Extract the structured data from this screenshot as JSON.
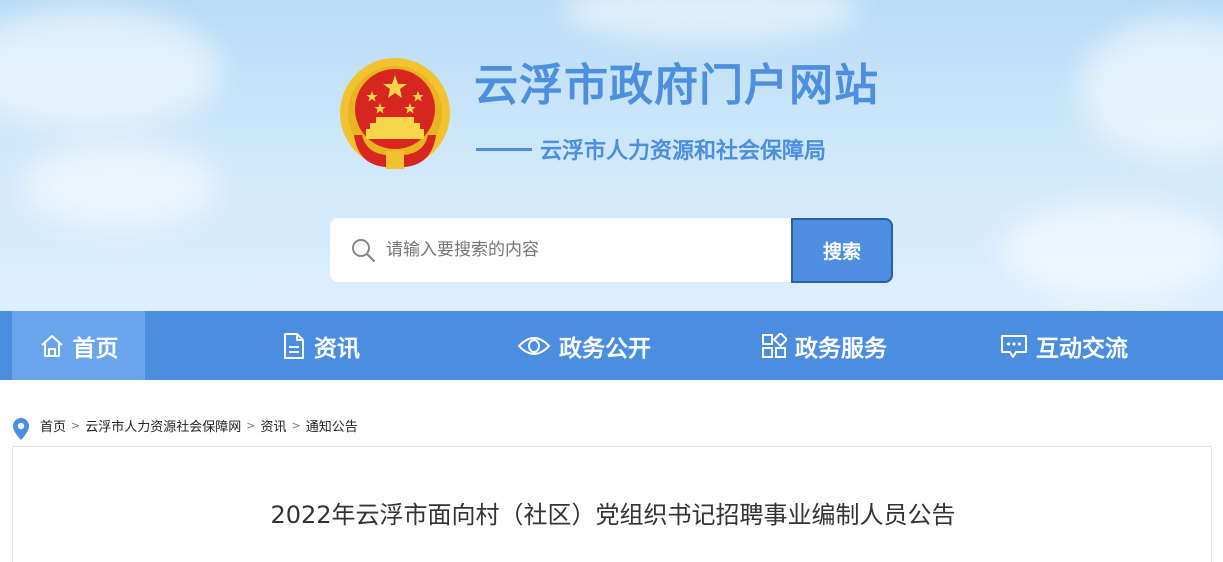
{
  "header": {
    "site_title": "云浮市政府门户网站",
    "dept_name": "云浮市人力资源和社会保障局",
    "emblem_icon": "national-emblem-icon"
  },
  "search": {
    "placeholder": "请输入要搜索的内容",
    "button_label": "搜索",
    "icon": "search-icon"
  },
  "nav": {
    "items": [
      {
        "label": "首页",
        "icon": "home-icon",
        "active": true
      },
      {
        "label": "资讯",
        "icon": "document-icon",
        "active": false
      },
      {
        "label": "政务公开",
        "icon": "eye-icon",
        "active": false
      },
      {
        "label": "政务服务",
        "icon": "grid-icon",
        "active": false
      },
      {
        "label": "互动交流",
        "icon": "chat-icon",
        "active": false
      }
    ]
  },
  "breadcrumb": {
    "icon": "location-pin-icon",
    "items": [
      "首页",
      "云浮市人力资源社会保障网",
      "资讯",
      "通知公告"
    ],
    "separator": ">"
  },
  "article": {
    "title": "2022年云浮市面向村（社区）党组织书记招聘事业编制人员公告"
  },
  "colors": {
    "brand_blue": "#4b8ddf",
    "nav_active": "#6aa5ec",
    "title_blue": "#4d8fdd",
    "emblem_red": "#d7261f",
    "emblem_gold": "#f2c230"
  }
}
